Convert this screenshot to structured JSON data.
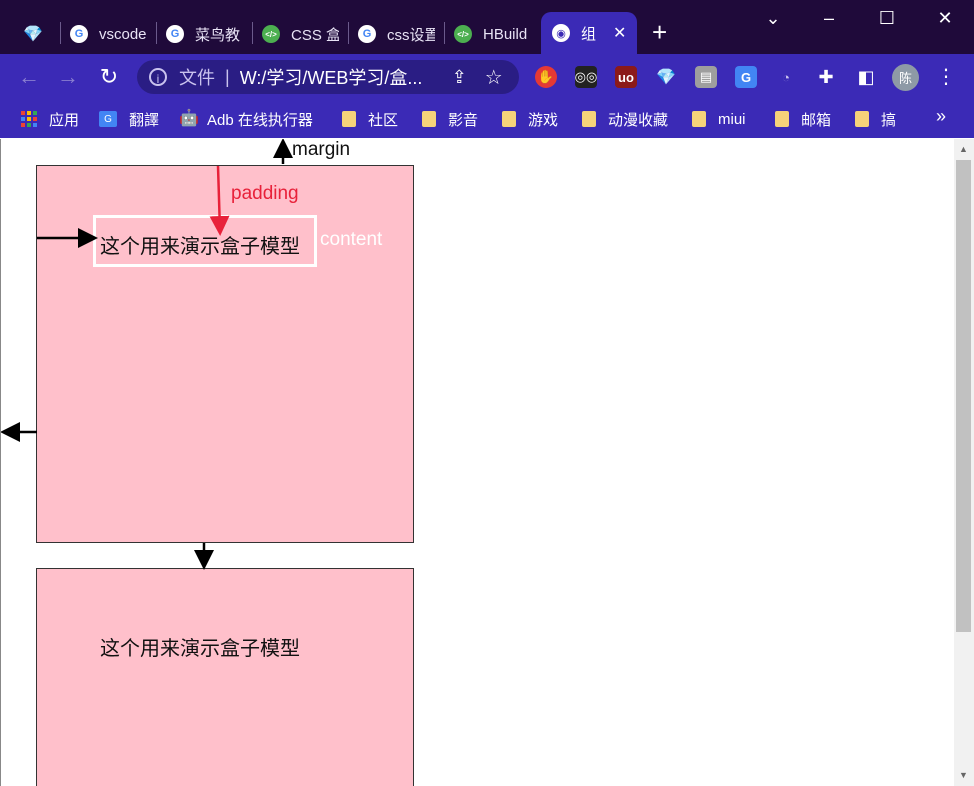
{
  "tabs": [
    {
      "title": "",
      "icon": "gem-icon"
    },
    {
      "title": "vscode",
      "icon": "google-icon"
    },
    {
      "title": "菜鸟教",
      "icon": "google-icon"
    },
    {
      "title": "CSS 盒",
      "icon": "code-icon"
    },
    {
      "title": "css设置",
      "icon": "google-icon"
    },
    {
      "title": "HBuild",
      "icon": "code-icon"
    },
    {
      "title": "组",
      "icon": "globe-icon",
      "active": true
    }
  ],
  "window": {
    "new_tab": "+",
    "minimize": "–",
    "maximize": "☐",
    "close": "✕",
    "tab_list": "⌄",
    "tab_close": "✕"
  },
  "toolbar": {
    "back": "←",
    "forward": "→",
    "reload": "↻",
    "info_icon": "i",
    "scheme": "文件",
    "divider": "|",
    "url": "W:/学习/WEB学习/盒...",
    "avatar_text": "陈",
    "menu": "⋮"
  },
  "extensions": [
    "adblock-icon",
    "tampermonkey-icon",
    "ublock-icon",
    "gem-icon",
    "reader-icon",
    "translate-icon",
    "speed-icon",
    "puzzle-icon",
    "sidepanel-icon"
  ],
  "bookmarks": {
    "items": [
      {
        "label": "应用",
        "icon": "apps-icon"
      },
      {
        "label": "翻譯",
        "icon": "translate-icon"
      },
      {
        "label": "Adb 在线执行器",
        "icon": "android-icon"
      },
      {
        "label": "社区",
        "icon": "folder-icon"
      },
      {
        "label": "影音",
        "icon": "folder-icon"
      },
      {
        "label": "游戏",
        "icon": "folder-icon"
      },
      {
        "label": "动漫收藏",
        "icon": "folder-icon"
      },
      {
        "label": "miui",
        "icon": "folder-icon"
      },
      {
        "label": "邮箱",
        "icon": "folder-icon"
      },
      {
        "label": "搞",
        "icon": "folder-icon"
      }
    ],
    "more": "»"
  },
  "page": {
    "box_text": "这个用来演示盒子模型",
    "labels": {
      "margin": "margin",
      "padding": "padding",
      "content": "content"
    },
    "colors": {
      "box_bg": "#ffc0cb",
      "padding_arrow": "#e8213a",
      "content_outline": "#ffffff"
    }
  }
}
